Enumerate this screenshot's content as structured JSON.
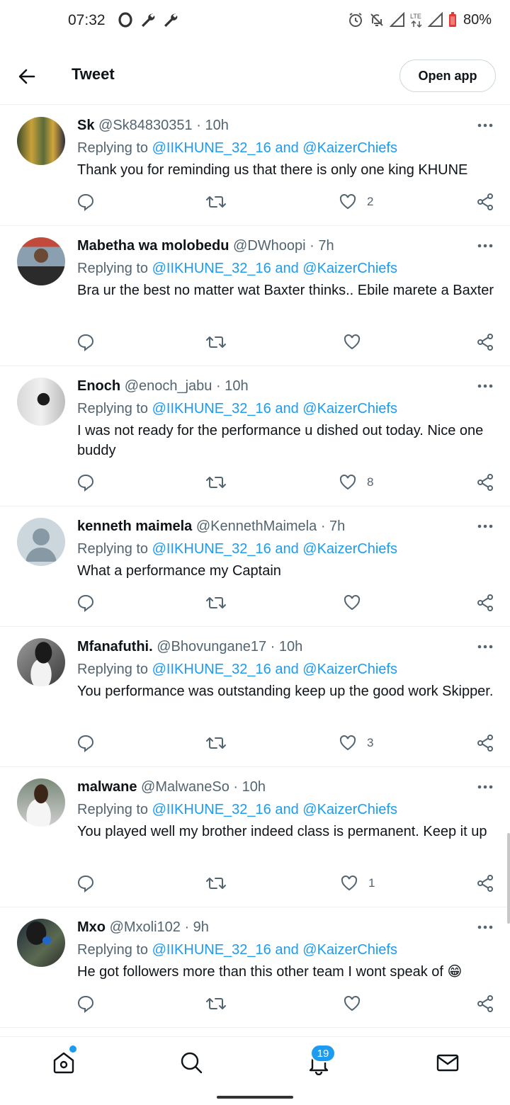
{
  "status_bar": {
    "time": "07:32",
    "battery": "80%",
    "network": "LTE"
  },
  "header": {
    "title": "Tweet",
    "open_app_label": "Open app"
  },
  "colors": {
    "accent": "#1d9bf0",
    "text": "#0f1419",
    "muted": "#536471"
  },
  "tweets": [
    {
      "name": "Sk",
      "handle": "@Sk84830351",
      "time": "· 10h",
      "replying_prefix": "Replying to",
      "replying_targets": "@IIKHUNE_32_16 and @KaizerChiefs",
      "text": "Thank you for reminding us that there is only one king KHUNE",
      "likes": "2"
    },
    {
      "name": "Mabetha wa molobedu",
      "handle": "@DWhoopi",
      "time": "· 7h",
      "replying_prefix": "Replying to",
      "replying_targets": "@IIKHUNE_32_16 and @KaizerChiefs",
      "text": "Bra ur the best no matter wat Baxter thinks.. Ebile marete a Baxter",
      "likes": ""
    },
    {
      "name": "Enoch",
      "handle": "@enoch_jabu",
      "time": "· 10h",
      "replying_prefix": "Replying to",
      "replying_targets": "@IIKHUNE_32_16 and @KaizerChiefs",
      "text": "I was not ready for the performance u dished  out today. Nice one  buddy",
      "likes": "8"
    },
    {
      "name": "kenneth maimela",
      "handle": "@KennethMaimela",
      "time": "· 7h",
      "replying_prefix": "Replying to",
      "replying_targets": "@IIKHUNE_32_16 and @KaizerChiefs",
      "text": "What a performance my Captain",
      "likes": ""
    },
    {
      "name": "Mfanafuthi.",
      "handle": "@Bhovungane17",
      "time": "· 10h",
      "replying_prefix": "Replying to",
      "replying_targets": "@IIKHUNE_32_16 and @KaizerChiefs",
      "text": "You performance was outstanding keep up the good work Skipper.",
      "likes": "3"
    },
    {
      "name": "malwane",
      "handle": "@MalwaneSo",
      "time": "· 10h",
      "replying_prefix": "Replying to",
      "replying_targets": "@IIKHUNE_32_16 and @KaizerChiefs",
      "text": "You played well my brother indeed class is permanent. Keep it up",
      "likes": "1"
    },
    {
      "name": "Mxo",
      "handle": "@Mxoli102",
      "time": "· 9h",
      "replying_prefix": "Replying to",
      "replying_targets": "@IIKHUNE_32_16 and @KaizerChiefs",
      "text": "He got followers more than this other team I wont speak of 😁",
      "likes": ""
    }
  ],
  "bottom_nav": {
    "notifications_badge": "19"
  }
}
